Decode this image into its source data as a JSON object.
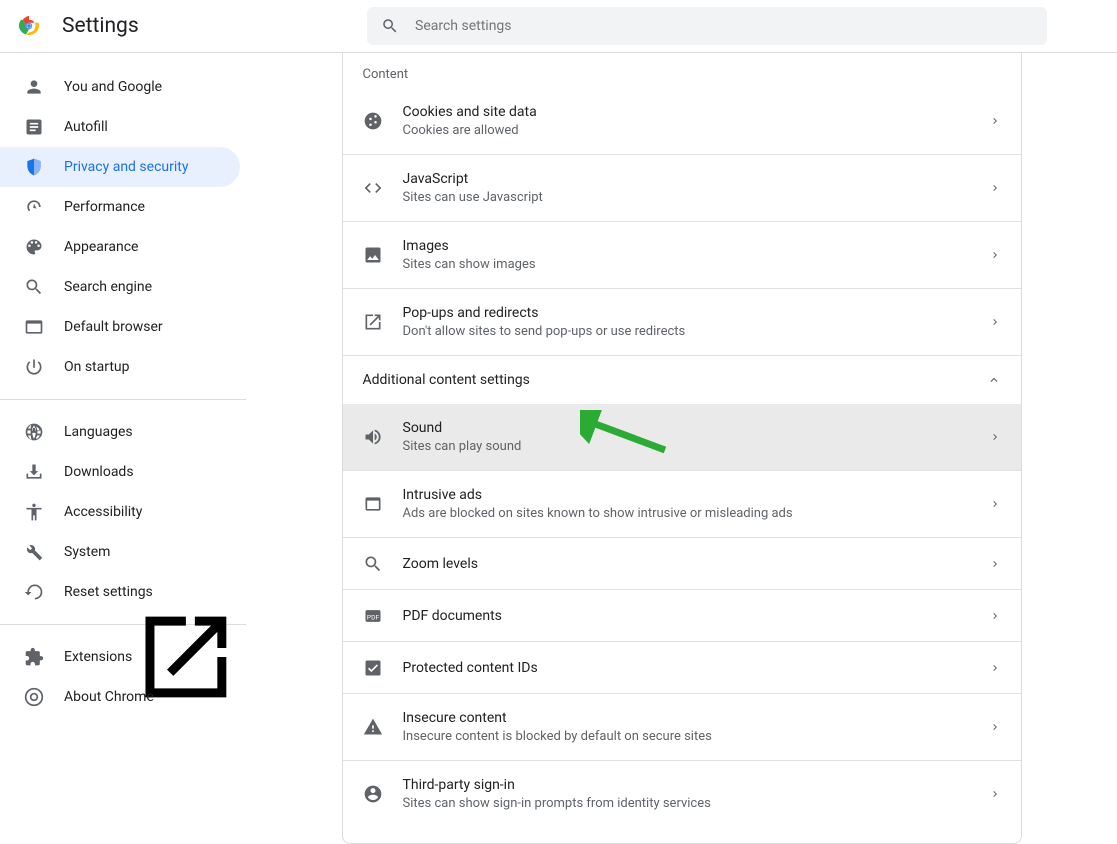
{
  "app": {
    "title": "Settings"
  },
  "search": {
    "placeholder": "Search settings"
  },
  "sidebar": {
    "items": [
      {
        "label": "You and Google",
        "icon": "person"
      },
      {
        "label": "Autofill",
        "icon": "autofill"
      },
      {
        "label": "Privacy and security",
        "icon": "shield",
        "active": true
      },
      {
        "label": "Performance",
        "icon": "speed"
      },
      {
        "label": "Appearance",
        "icon": "palette"
      },
      {
        "label": "Search engine",
        "icon": "search"
      },
      {
        "label": "Default browser",
        "icon": "browser"
      },
      {
        "label": "On startup",
        "icon": "power"
      }
    ],
    "items2": [
      {
        "label": "Languages",
        "icon": "globe"
      },
      {
        "label": "Downloads",
        "icon": "download"
      },
      {
        "label": "Accessibility",
        "icon": "access"
      },
      {
        "label": "System",
        "icon": "wrench"
      },
      {
        "label": "Reset settings",
        "icon": "reset"
      }
    ],
    "items3": [
      {
        "label": "Extensions",
        "icon": "puzzle",
        "ext": true
      },
      {
        "label": "About Chrome",
        "icon": "chrome"
      }
    ]
  },
  "content": {
    "section_title": "Content",
    "rows": [
      {
        "title": "Cookies and site data",
        "subtitle": "Cookies are allowed",
        "icon": "cookie"
      },
      {
        "title": "JavaScript",
        "subtitle": "Sites can use Javascript",
        "icon": "code"
      },
      {
        "title": "Images",
        "subtitle": "Sites can show images",
        "icon": "image"
      },
      {
        "title": "Pop-ups and redirects",
        "subtitle": "Don't allow sites to send pop-ups or use redirects",
        "icon": "launch"
      }
    ],
    "expander": "Additional content settings",
    "rows2": [
      {
        "title": "Sound",
        "subtitle": "Sites can play sound",
        "icon": "sound",
        "hover": true
      },
      {
        "title": "Intrusive ads",
        "subtitle": "Ads are blocked on sites known to show intrusive or misleading ads",
        "icon": "webasset"
      },
      {
        "title": "Zoom levels",
        "subtitle": "",
        "icon": "zoom"
      },
      {
        "title": "PDF documents",
        "subtitle": "",
        "icon": "pdf"
      },
      {
        "title": "Protected content IDs",
        "subtitle": "",
        "icon": "protected"
      },
      {
        "title": "Insecure content",
        "subtitle": "Insecure content is blocked by default on secure sites",
        "icon": "warn"
      },
      {
        "title": "Third-party sign-in",
        "subtitle": "Sites can show sign-in prompts from identity services",
        "icon": "account"
      }
    ]
  }
}
